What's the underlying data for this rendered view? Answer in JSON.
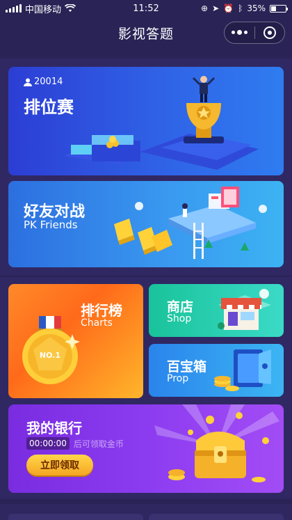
{
  "status_bar": {
    "carrier": "中国移动",
    "time": "11:52",
    "battery": "35%",
    "battery_level": 0.35
  },
  "nav": {
    "title": "影视答题"
  },
  "cards": {
    "ranked": {
      "count": "20014",
      "title": "排位赛"
    },
    "friends": {
      "title": "好友对战",
      "subtitle": "PK Friends",
      "badge_text": "PK"
    },
    "charts": {
      "title": "排行榜",
      "subtitle": "Charts",
      "medal": "NO.1"
    },
    "shop": {
      "title": "商店",
      "subtitle": "Shop"
    },
    "prop": {
      "title": "百宝箱",
      "subtitle": "Prop"
    },
    "bank": {
      "title": "我的银行",
      "timer": "00:00:00",
      "hint": "后可领取金币",
      "button": "立即领取"
    }
  },
  "colors": {
    "background": "#2a2356",
    "gold": "#f5b82e",
    "bank_purple": "#8c3cf0"
  }
}
